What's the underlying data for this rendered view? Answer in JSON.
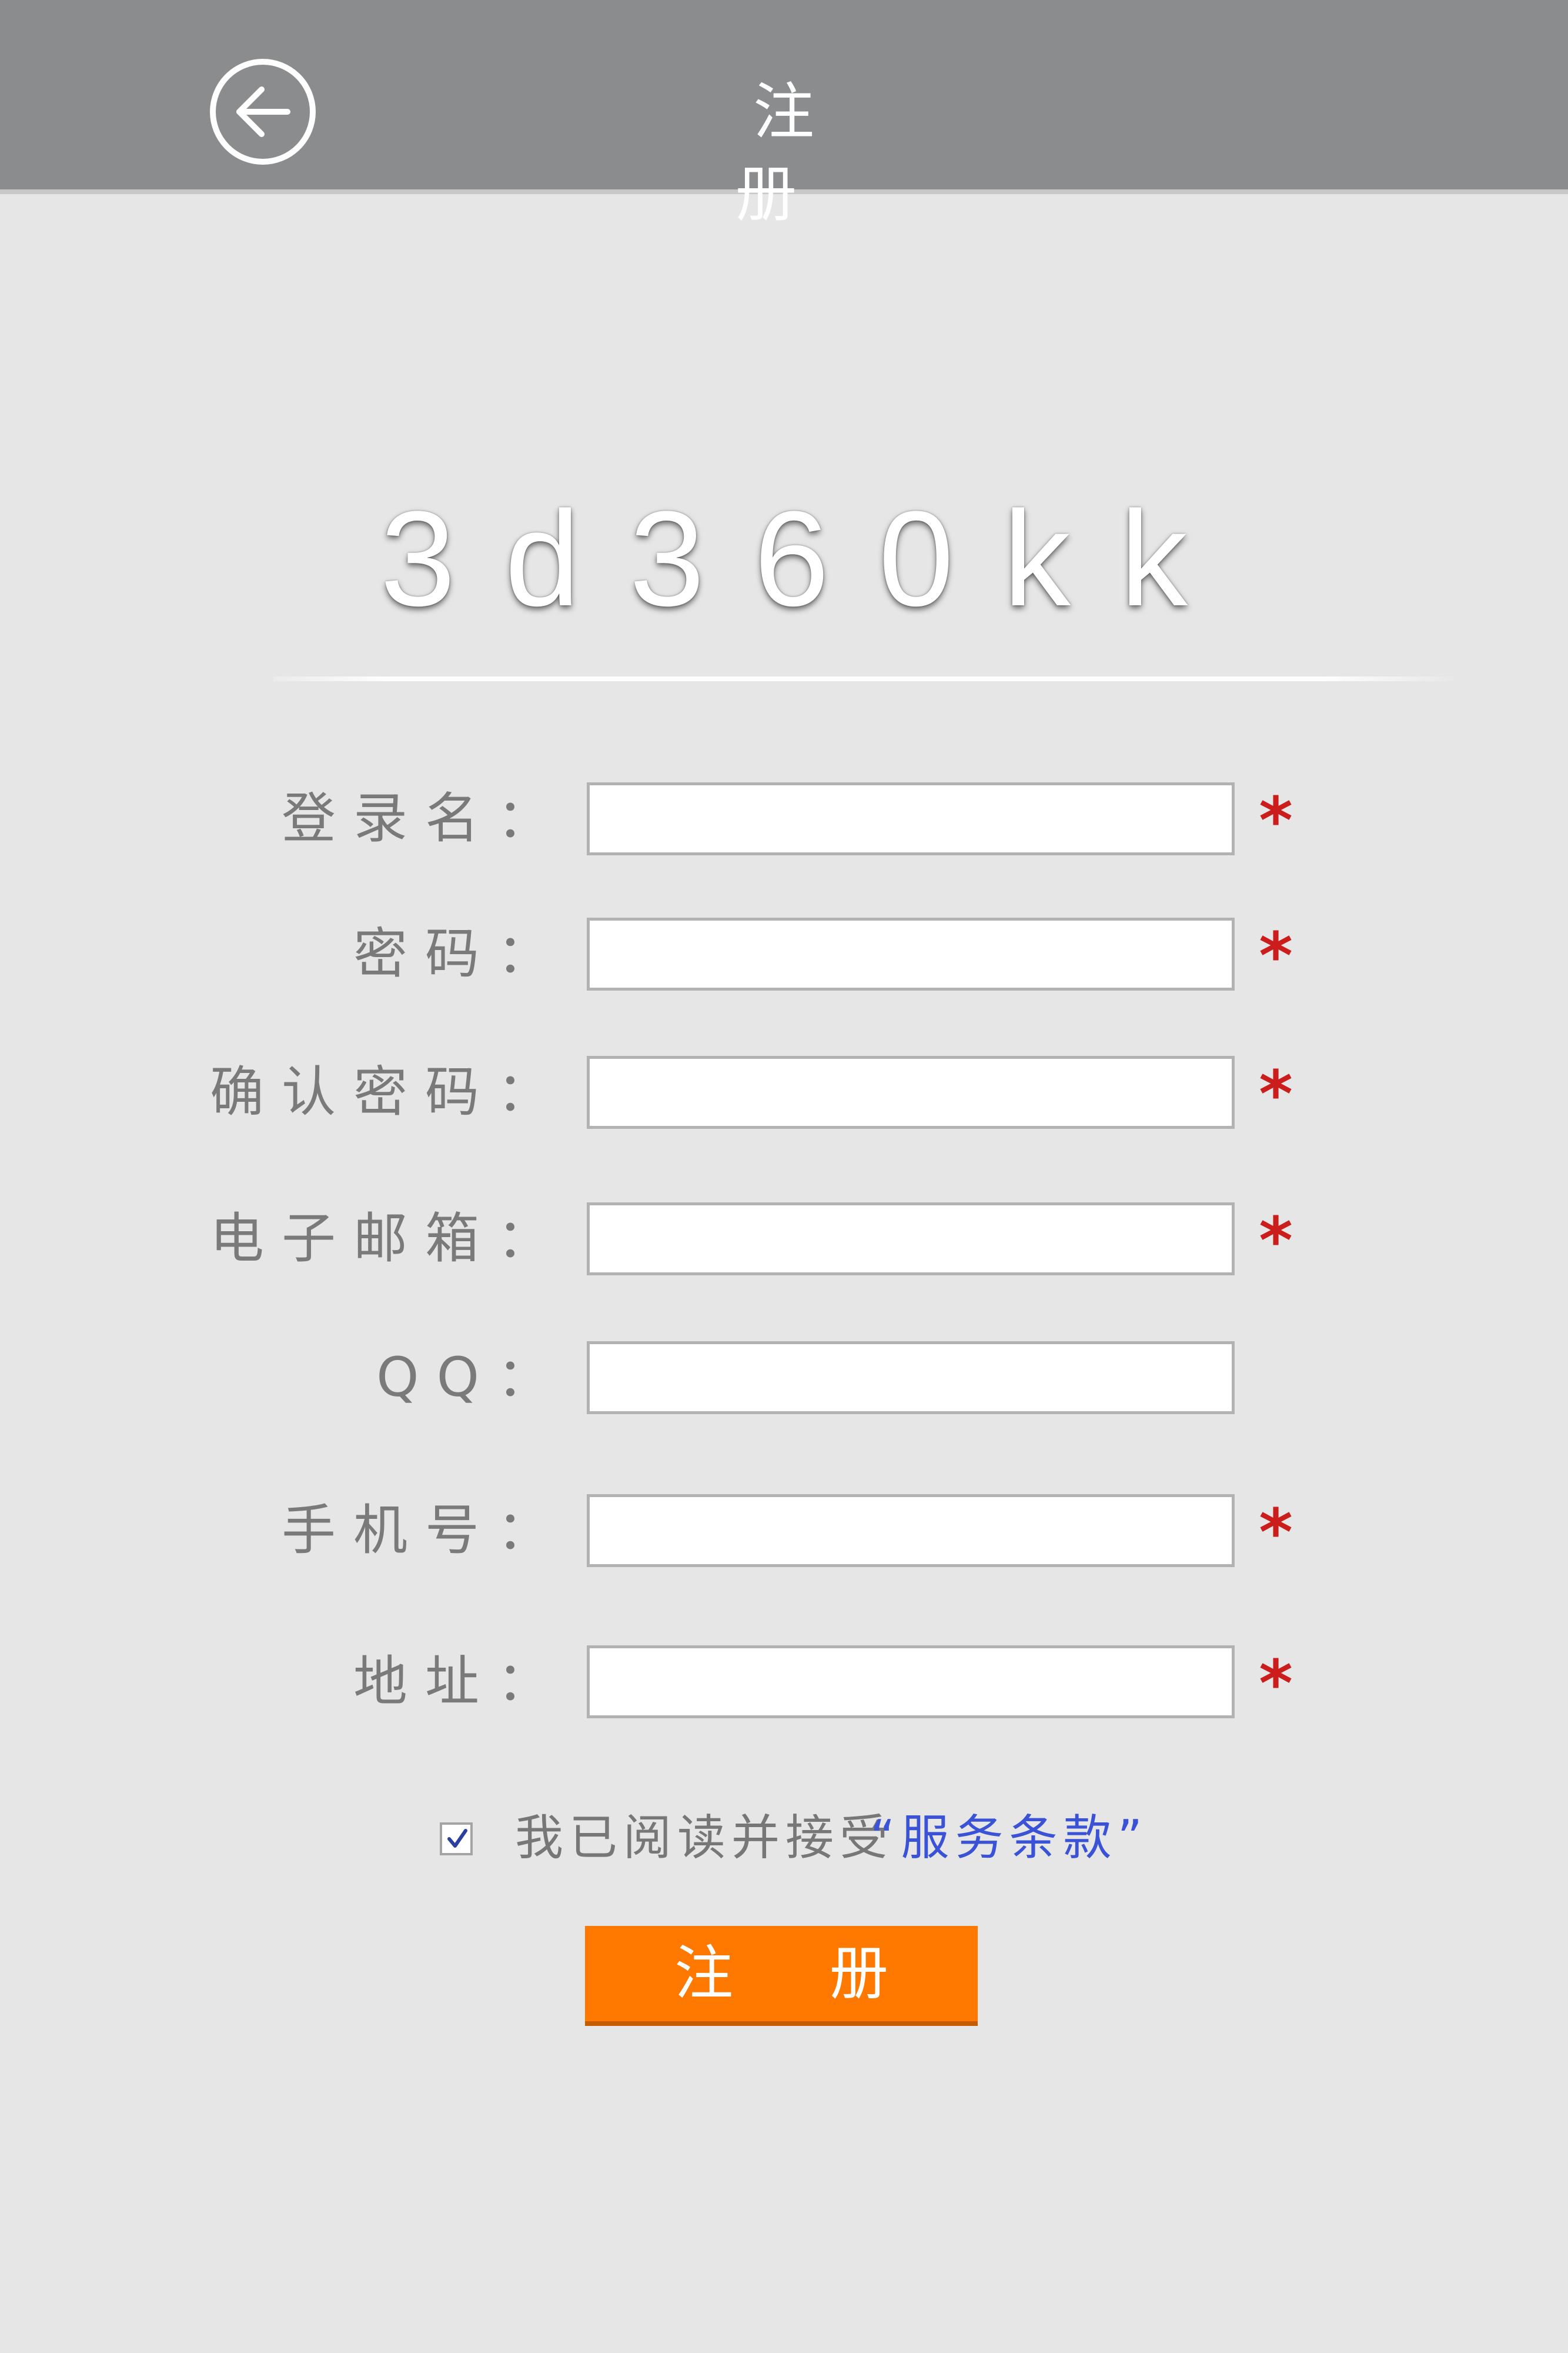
{
  "header": {
    "title": "注 册",
    "back_icon": "arrow-left-circle-icon"
  },
  "brand": {
    "text": "3d360kk"
  },
  "form": {
    "fields": [
      {
        "label": "登录名：",
        "value": "",
        "required_mark": "*"
      },
      {
        "label": "密码：",
        "value": "",
        "required_mark": "*"
      },
      {
        "label": "确认密码：",
        "value": "",
        "required_mark": "*"
      },
      {
        "label": "电子邮箱：",
        "value": "",
        "required_mark": "*"
      },
      {
        "label": "QQ：",
        "value": "",
        "required_mark": ""
      },
      {
        "label": "手机号：",
        "value": "",
        "required_mark": "*"
      },
      {
        "label": "地址：",
        "value": "",
        "required_mark": "*"
      }
    ]
  },
  "agreement": {
    "checked": true,
    "text": "我已阅读并接受",
    "link_text": "“服务条款”"
  },
  "submit": {
    "label": "注 册"
  },
  "colors": {
    "header_bg": "#8b8c8e",
    "page_bg": "#e6e6e6",
    "required": "#cc1d1d",
    "link": "#3a52d6",
    "submit_bg": "#ff7800"
  }
}
